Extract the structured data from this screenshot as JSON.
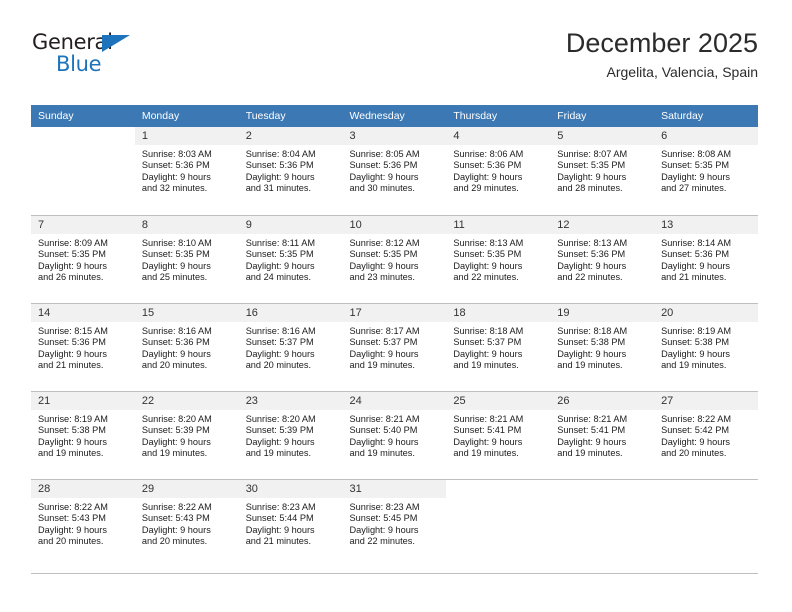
{
  "brand": {
    "name_part1": "General",
    "name_part2": "Blue",
    "accent_color": "#1d74bd"
  },
  "header": {
    "title": "December 2025",
    "subtitle": "Argelita, Valencia, Spain",
    "header_bg_color": "#3c78b4"
  },
  "weekday_headers": [
    "Sunday",
    "Monday",
    "Tuesday",
    "Wednesday",
    "Thursday",
    "Friday",
    "Saturday"
  ],
  "weeks": [
    [
      {
        "day": "",
        "sunrise": "",
        "sunset": "",
        "daylight_line1": "",
        "daylight_line2": ""
      },
      {
        "day": "1",
        "sunrise": "Sunrise: 8:03 AM",
        "sunset": "Sunset: 5:36 PM",
        "daylight_line1": "Daylight: 9 hours",
        "daylight_line2": "and 32 minutes."
      },
      {
        "day": "2",
        "sunrise": "Sunrise: 8:04 AM",
        "sunset": "Sunset: 5:36 PM",
        "daylight_line1": "Daylight: 9 hours",
        "daylight_line2": "and 31 minutes."
      },
      {
        "day": "3",
        "sunrise": "Sunrise: 8:05 AM",
        "sunset": "Sunset: 5:36 PM",
        "daylight_line1": "Daylight: 9 hours",
        "daylight_line2": "and 30 minutes."
      },
      {
        "day": "4",
        "sunrise": "Sunrise: 8:06 AM",
        "sunset": "Sunset: 5:36 PM",
        "daylight_line1": "Daylight: 9 hours",
        "daylight_line2": "and 29 minutes."
      },
      {
        "day": "5",
        "sunrise": "Sunrise: 8:07 AM",
        "sunset": "Sunset: 5:35 PM",
        "daylight_line1": "Daylight: 9 hours",
        "daylight_line2": "and 28 minutes."
      },
      {
        "day": "6",
        "sunrise": "Sunrise: 8:08 AM",
        "sunset": "Sunset: 5:35 PM",
        "daylight_line1": "Daylight: 9 hours",
        "daylight_line2": "and 27 minutes."
      }
    ],
    [
      {
        "day": "7",
        "sunrise": "Sunrise: 8:09 AM",
        "sunset": "Sunset: 5:35 PM",
        "daylight_line1": "Daylight: 9 hours",
        "daylight_line2": "and 26 minutes."
      },
      {
        "day": "8",
        "sunrise": "Sunrise: 8:10 AM",
        "sunset": "Sunset: 5:35 PM",
        "daylight_line1": "Daylight: 9 hours",
        "daylight_line2": "and 25 minutes."
      },
      {
        "day": "9",
        "sunrise": "Sunrise: 8:11 AM",
        "sunset": "Sunset: 5:35 PM",
        "daylight_line1": "Daylight: 9 hours",
        "daylight_line2": "and 24 minutes."
      },
      {
        "day": "10",
        "sunrise": "Sunrise: 8:12 AM",
        "sunset": "Sunset: 5:35 PM",
        "daylight_line1": "Daylight: 9 hours",
        "daylight_line2": "and 23 minutes."
      },
      {
        "day": "11",
        "sunrise": "Sunrise: 8:13 AM",
        "sunset": "Sunset: 5:35 PM",
        "daylight_line1": "Daylight: 9 hours",
        "daylight_line2": "and 22 minutes."
      },
      {
        "day": "12",
        "sunrise": "Sunrise: 8:13 AM",
        "sunset": "Sunset: 5:36 PM",
        "daylight_line1": "Daylight: 9 hours",
        "daylight_line2": "and 22 minutes."
      },
      {
        "day": "13",
        "sunrise": "Sunrise: 8:14 AM",
        "sunset": "Sunset: 5:36 PM",
        "daylight_line1": "Daylight: 9 hours",
        "daylight_line2": "and 21 minutes."
      }
    ],
    [
      {
        "day": "14",
        "sunrise": "Sunrise: 8:15 AM",
        "sunset": "Sunset: 5:36 PM",
        "daylight_line1": "Daylight: 9 hours",
        "daylight_line2": "and 21 minutes."
      },
      {
        "day": "15",
        "sunrise": "Sunrise: 8:16 AM",
        "sunset": "Sunset: 5:36 PM",
        "daylight_line1": "Daylight: 9 hours",
        "daylight_line2": "and 20 minutes."
      },
      {
        "day": "16",
        "sunrise": "Sunrise: 8:16 AM",
        "sunset": "Sunset: 5:37 PM",
        "daylight_line1": "Daylight: 9 hours",
        "daylight_line2": "and 20 minutes."
      },
      {
        "day": "17",
        "sunrise": "Sunrise: 8:17 AM",
        "sunset": "Sunset: 5:37 PM",
        "daylight_line1": "Daylight: 9 hours",
        "daylight_line2": "and 19 minutes."
      },
      {
        "day": "18",
        "sunrise": "Sunrise: 8:18 AM",
        "sunset": "Sunset: 5:37 PM",
        "daylight_line1": "Daylight: 9 hours",
        "daylight_line2": "and 19 minutes."
      },
      {
        "day": "19",
        "sunrise": "Sunrise: 8:18 AM",
        "sunset": "Sunset: 5:38 PM",
        "daylight_line1": "Daylight: 9 hours",
        "daylight_line2": "and 19 minutes."
      },
      {
        "day": "20",
        "sunrise": "Sunrise: 8:19 AM",
        "sunset": "Sunset: 5:38 PM",
        "daylight_line1": "Daylight: 9 hours",
        "daylight_line2": "and 19 minutes."
      }
    ],
    [
      {
        "day": "21",
        "sunrise": "Sunrise: 8:19 AM",
        "sunset": "Sunset: 5:38 PM",
        "daylight_line1": "Daylight: 9 hours",
        "daylight_line2": "and 19 minutes."
      },
      {
        "day": "22",
        "sunrise": "Sunrise: 8:20 AM",
        "sunset": "Sunset: 5:39 PM",
        "daylight_line1": "Daylight: 9 hours",
        "daylight_line2": "and 19 minutes."
      },
      {
        "day": "23",
        "sunrise": "Sunrise: 8:20 AM",
        "sunset": "Sunset: 5:39 PM",
        "daylight_line1": "Daylight: 9 hours",
        "daylight_line2": "and 19 minutes."
      },
      {
        "day": "24",
        "sunrise": "Sunrise: 8:21 AM",
        "sunset": "Sunset: 5:40 PM",
        "daylight_line1": "Daylight: 9 hours",
        "daylight_line2": "and 19 minutes."
      },
      {
        "day": "25",
        "sunrise": "Sunrise: 8:21 AM",
        "sunset": "Sunset: 5:41 PM",
        "daylight_line1": "Daylight: 9 hours",
        "daylight_line2": "and 19 minutes."
      },
      {
        "day": "26",
        "sunrise": "Sunrise: 8:21 AM",
        "sunset": "Sunset: 5:41 PM",
        "daylight_line1": "Daylight: 9 hours",
        "daylight_line2": "and 19 minutes."
      },
      {
        "day": "27",
        "sunrise": "Sunrise: 8:22 AM",
        "sunset": "Sunset: 5:42 PM",
        "daylight_line1": "Daylight: 9 hours",
        "daylight_line2": "and 20 minutes."
      }
    ],
    [
      {
        "day": "28",
        "sunrise": "Sunrise: 8:22 AM",
        "sunset": "Sunset: 5:43 PM",
        "daylight_line1": "Daylight: 9 hours",
        "daylight_line2": "and 20 minutes."
      },
      {
        "day": "29",
        "sunrise": "Sunrise: 8:22 AM",
        "sunset": "Sunset: 5:43 PM",
        "daylight_line1": "Daylight: 9 hours",
        "daylight_line2": "and 20 minutes."
      },
      {
        "day": "30",
        "sunrise": "Sunrise: 8:23 AM",
        "sunset": "Sunset: 5:44 PM",
        "daylight_line1": "Daylight: 9 hours",
        "daylight_line2": "and 21 minutes."
      },
      {
        "day": "31",
        "sunrise": "Sunrise: 8:23 AM",
        "sunset": "Sunset: 5:45 PM",
        "daylight_line1": "Daylight: 9 hours",
        "daylight_line2": "and 22 minutes."
      },
      {
        "day": "",
        "sunrise": "",
        "sunset": "",
        "daylight_line1": "",
        "daylight_line2": ""
      },
      {
        "day": "",
        "sunrise": "",
        "sunset": "",
        "daylight_line1": "",
        "daylight_line2": ""
      },
      {
        "day": "",
        "sunrise": "",
        "sunset": "",
        "daylight_line1": "",
        "daylight_line2": ""
      }
    ]
  ]
}
